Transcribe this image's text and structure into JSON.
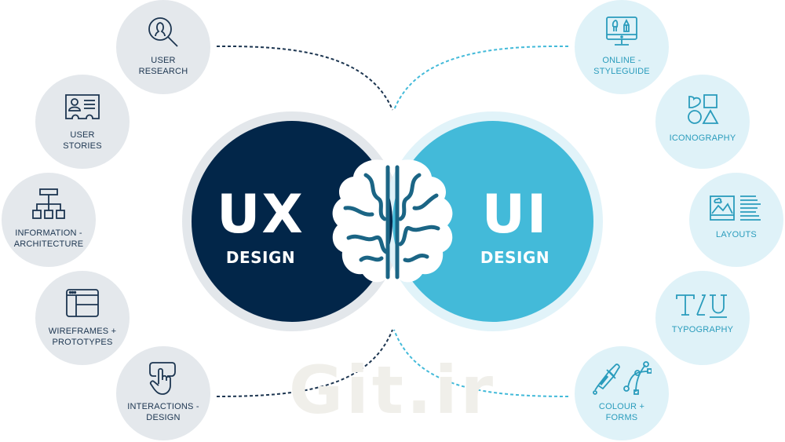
{
  "watermark": "Git.ir",
  "colors": {
    "ux_primary": "#022649",
    "ux_ring": "#e3e7eb",
    "ui_primary": "#43bad9",
    "ui_ring": "#def2f8",
    "overlap": "#1b6585",
    "ux_icon": "#1c3550",
    "ui_icon": "#2a9cbc"
  },
  "ux": {
    "title": "UX",
    "subtitle": "DESIGN"
  },
  "ui": {
    "title": "UI",
    "subtitle": "DESIGN"
  },
  "center_icon": "brain-icon",
  "ux_items": [
    {
      "label": "USER\nRESEARCH",
      "icon": "user-search-icon"
    },
    {
      "label": "USER\nSTORIES",
      "icon": "id-card-icon"
    },
    {
      "label": "INFORMATION -\nARCHITECTURE",
      "icon": "sitemap-icon"
    },
    {
      "label": "WIREFRAMES +\nPROTOTYPES",
      "icon": "browser-window-icon"
    },
    {
      "label": "INTERACTIONS -\nDESIGN",
      "icon": "touch-hand-icon"
    }
  ],
  "ui_items": [
    {
      "label": "ONLINE -\nSTYLEGUIDE",
      "icon": "monitor-brush-pencil-icon"
    },
    {
      "label": "ICONOGRAPHY",
      "icon": "shapes-icon"
    },
    {
      "label": "LAYOUTS",
      "icon": "image-text-layout-icon"
    },
    {
      "label": "TYPOGRAPHY",
      "icon": "type-icon"
    },
    {
      "label": "COLOUR +\nFORMS",
      "icon": "pipette-vector-icon"
    }
  ]
}
